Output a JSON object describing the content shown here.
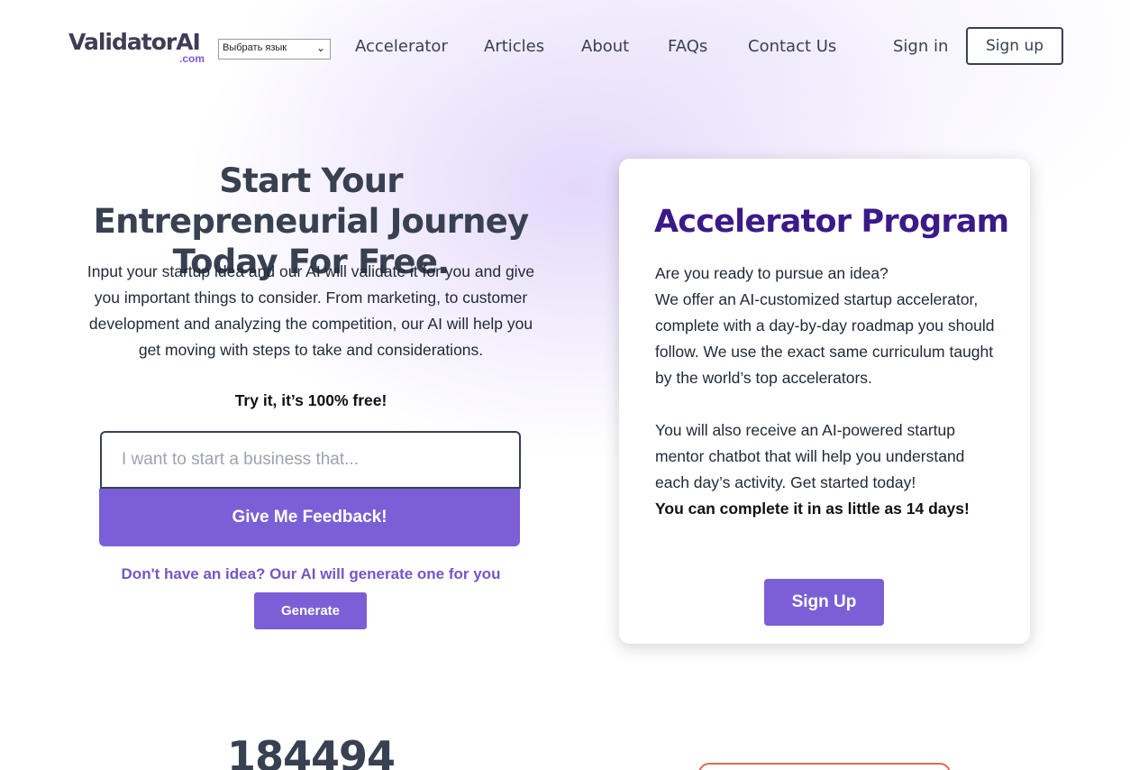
{
  "header": {
    "logo": {
      "main": "ValidatorAI",
      "suffix": ".com"
    },
    "language_select": {
      "value": "Выбрать язык",
      "caret": "⌄"
    },
    "nav": [
      {
        "label": "Accelerator"
      },
      {
        "label": "Articles"
      },
      {
        "label": "About"
      },
      {
        "label": "FAQs"
      },
      {
        "label": "Contact Us"
      }
    ],
    "signin_label": "Sign in",
    "signup_label": "Sign up"
  },
  "hero": {
    "title": "Start Your Entrepreneurial Journey Today For Free.",
    "description": "Input your startup idea and our AI will validate it for you and give you important things to consider. From marketing, to customer development and analyzing the competition, our AI will help you get moving with steps to take and considerations.",
    "free_note": "Try it, it’s 100% free!",
    "input_placeholder": "I want to start a business that...",
    "feedback_button": "Give Me Feedback!",
    "no_idea_text": "Don't have an idea? Our AI will generate one for you",
    "generate_button": "Generate"
  },
  "accelerator_card": {
    "title": "Accelerator Program",
    "paragraph1_line1": "Are you ready to pursue an idea?",
    "paragraph1_rest": "We offer an AI-customized startup accelerator, complete with a day-by-day roadmap you should follow. We use the exact same curriculum taught by the world’s top accelerators.",
    "paragraph2": "You will also receive an AI-powered startup mentor chatbot that will help you understand each day’s activity. Get started today!",
    "highlight": "You can complete it in as little as 14 days!",
    "signup_button": "Sign Up"
  },
  "stats": {
    "counter": "184494"
  },
  "colors": {
    "accent": "#7b5fd6",
    "card_title": "#3b1a88",
    "text_dark": "#374151"
  }
}
